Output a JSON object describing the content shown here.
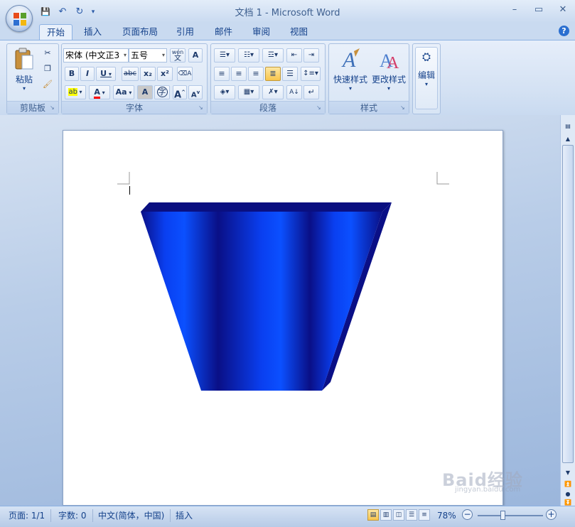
{
  "app": {
    "title": "文档 1 - Microsoft Word"
  },
  "window_controls": {
    "minimize": "–",
    "maximize": "▭",
    "close": "✕"
  },
  "quick_access": {
    "save": "💾",
    "undo": "↶",
    "redo": "↻",
    "more": "▾"
  },
  "tabs": [
    {
      "label": "开始",
      "active": true
    },
    {
      "label": "插入"
    },
    {
      "label": "页面布局"
    },
    {
      "label": "引用"
    },
    {
      "label": "邮件"
    },
    {
      "label": "审阅"
    },
    {
      "label": "视图"
    }
  ],
  "ribbon": {
    "clipboard": {
      "label": "剪贴板",
      "paste": "粘贴"
    },
    "font": {
      "label": "字体",
      "font_name": "宋体 (中文正3",
      "font_size": "五号",
      "phonetic": "wén",
      "bold": "B",
      "italic": "I",
      "underline": "U",
      "strike": "abc",
      "subscript": "x₂",
      "superscript": "x²",
      "highlight": "ab",
      "font_color": "A",
      "change_case": "Aa",
      "char_shading": "A",
      "enclose": "字",
      "grow": "A",
      "shrink": "A"
    },
    "paragraph": {
      "label": "段落"
    },
    "styles": {
      "label": "样式",
      "quick_styles": "快速样式",
      "change_styles": "更改样式"
    },
    "editing": {
      "label": "编辑"
    }
  },
  "statusbar": {
    "page": "页面: 1/1",
    "words": "字数: 0",
    "language": "中文(简体，中国)",
    "mode": "插入",
    "zoom": "78%",
    "zoom_level": 0.78
  },
  "watermark": {
    "text": "Baid经验",
    "sub": "jingyan.baidu.com"
  },
  "colors": {
    "shape_dark": "#0a0f86",
    "shape_light": "#0a4cff",
    "highlight": "#ffff00",
    "font_color": "#ff0000"
  }
}
